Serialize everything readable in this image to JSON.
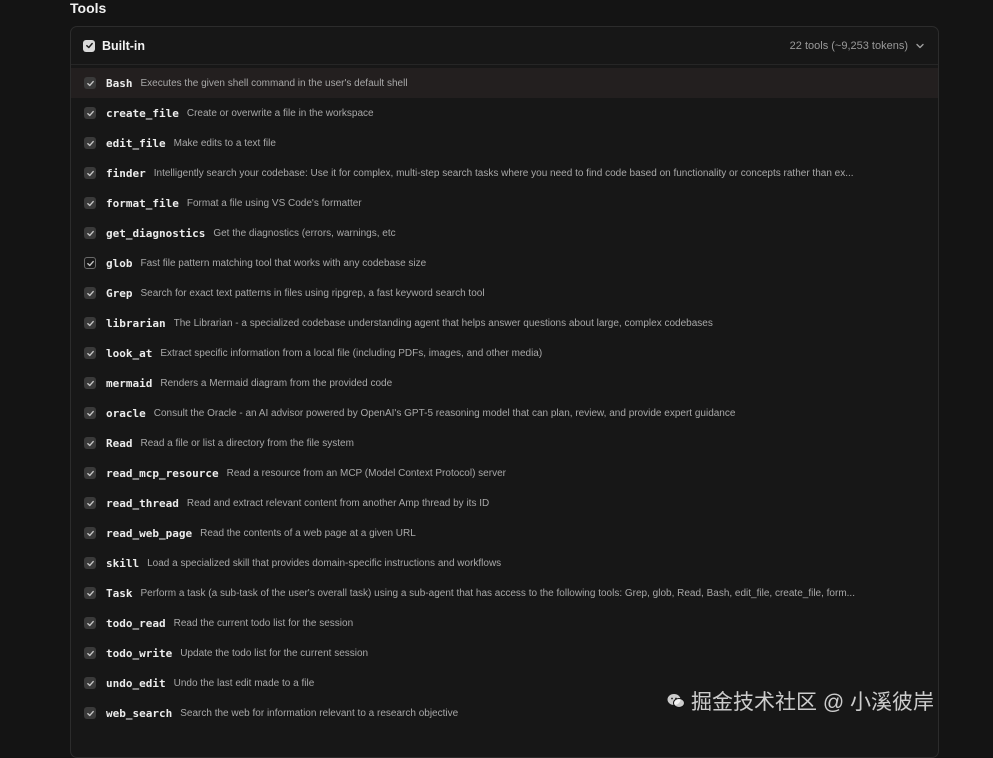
{
  "section": {
    "title": "Tools"
  },
  "panel": {
    "title": "Built-in",
    "summary": "22 tools (~9,253 tokens)"
  },
  "tools": [
    {
      "name": "Bash",
      "description": "Executes the given shell command in the user's default shell"
    },
    {
      "name": "create_file",
      "description": "Create or overwrite a file in the workspace"
    },
    {
      "name": "edit_file",
      "description": "Make edits to a text file"
    },
    {
      "name": "finder",
      "description": "Intelligently search your codebase: Use it for complex, multi-step search tasks where you need to find code based on functionality or concepts rather than ex..."
    },
    {
      "name": "format_file",
      "description": "Format a file using VS Code's formatter"
    },
    {
      "name": "get_diagnostics",
      "description": "Get the diagnostics (errors, warnings, etc"
    },
    {
      "name": "glob",
      "description": "Fast file pattern matching tool that works with any codebase size"
    },
    {
      "name": "Grep",
      "description": "Search for exact text patterns in files using ripgrep, a fast keyword search tool"
    },
    {
      "name": "librarian",
      "description": "The Librarian - a specialized codebase understanding agent that helps answer questions about large, complex codebases"
    },
    {
      "name": "look_at",
      "description": "Extract specific information from a local file (including PDFs, images, and other media)"
    },
    {
      "name": "mermaid",
      "description": "Renders a Mermaid diagram from the provided code"
    },
    {
      "name": "oracle",
      "description": "Consult the Oracle - an AI advisor powered by OpenAI's GPT-5 reasoning model that can plan, review, and provide expert guidance"
    },
    {
      "name": "Read",
      "description": "Read a file or list a directory from the file system"
    },
    {
      "name": "read_mcp_resource",
      "description": "Read a resource from an MCP (Model Context Protocol) server"
    },
    {
      "name": "read_thread",
      "description": "Read and extract relevant content from another Amp thread by its ID"
    },
    {
      "name": "read_web_page",
      "description": "Read the contents of a web page at a given URL"
    },
    {
      "name": "skill",
      "description": "Load a specialized skill that provides domain-specific instructions and workflows"
    },
    {
      "name": "Task",
      "description": "Perform a task (a sub-task of the user's overall task) using a sub-agent that has access to the following tools: Grep, glob, Read, Bash, edit_file, create_file, form..."
    },
    {
      "name": "todo_read",
      "description": "Read the current todo list for the session"
    },
    {
      "name": "todo_write",
      "description": "Update the todo list for the current session"
    },
    {
      "name": "undo_edit",
      "description": "Undo the last edit made to a file"
    },
    {
      "name": "web_search",
      "description": "Search the web for information relevant to a research objective"
    }
  ],
  "watermark": {
    "text": "掘金技术社区 @ 小溪彼岸"
  },
  "icons": {
    "checkbox": "checkmark-icon",
    "collapse": "chevron-down-icon",
    "watermark": "wechat-icon"
  },
  "colors": {
    "background": "#141414",
    "panel": "#171717",
    "hover_row": "#231f1f"
  }
}
